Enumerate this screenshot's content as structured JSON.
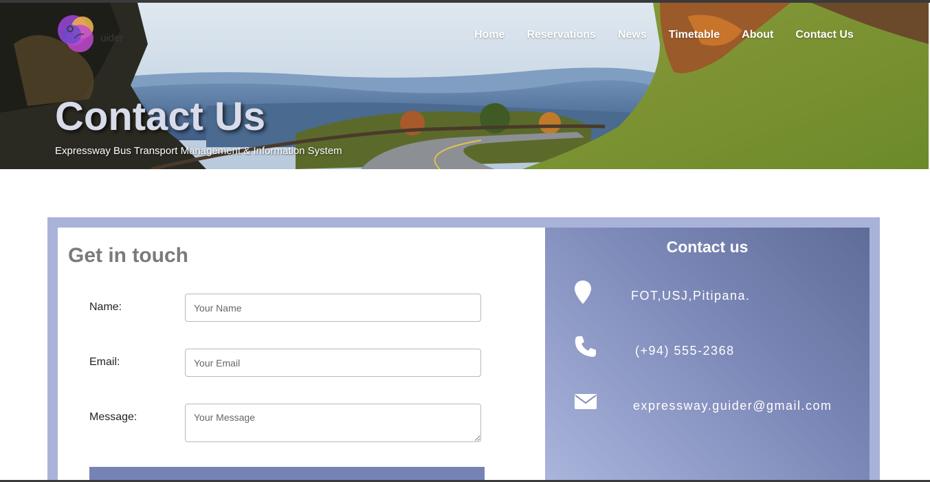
{
  "brand": {
    "logo_text": "uider"
  },
  "nav": [
    {
      "label": "Home"
    },
    {
      "label": "Reservations"
    },
    {
      "label": "News"
    },
    {
      "label": "Timetable"
    },
    {
      "label": "About"
    },
    {
      "label": "Contact Us"
    }
  ],
  "hero": {
    "title": "Contact Us",
    "subtitle": "Expressway Bus Transport Management & Information System"
  },
  "form": {
    "title": "Get in touch",
    "name_label": "Name:",
    "name_placeholder": "Your Name",
    "email_label": "Email:",
    "email_placeholder": "Your Email",
    "message_label": "Message:",
    "message_placeholder": "Your Message"
  },
  "contact": {
    "title": "Contact us",
    "address": "FOT,USJ,Pitipana.",
    "phone": "(+94) 555-2368",
    "email": "expressway.guider@gmail.com",
    "icons": [
      "map-pin-icon",
      "phone-icon",
      "envelope-icon"
    ]
  },
  "colors": {
    "frame": "#a9b3d9",
    "panel_dark": "#5f6b98",
    "panel_light": "#aab5dd",
    "button": "#7583b5",
    "title_gray": "#7a7a7a"
  }
}
